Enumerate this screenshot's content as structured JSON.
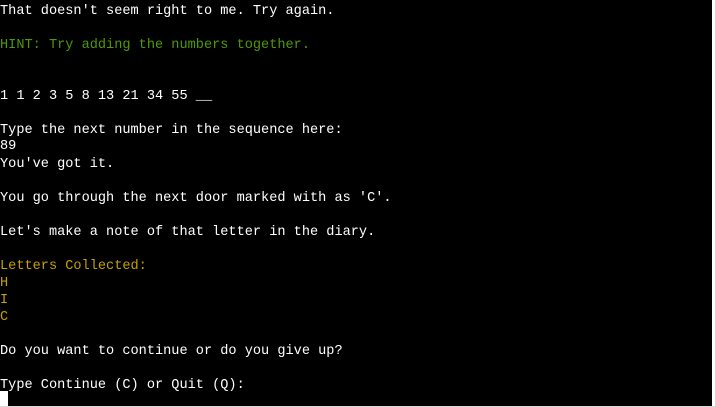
{
  "colors": {
    "background": "#000000",
    "text": "#ffffff",
    "hint": "#4e9a06",
    "letters": "#c4a000"
  },
  "terminal": {
    "error_message": "That doesn't seem right to me. Try again.",
    "hint": "HINT: Try adding the numbers together.",
    "sequence": "1 1 2 3 5 8 13 21 34 55 __",
    "prompt": "Type the next number in the sequence here:",
    "user_input": "89",
    "success": "You've got it.",
    "door_message": "You go through the next door marked with as 'C'.",
    "diary_message": "Let's make a note of that letter in the diary.",
    "letters_header": "Letters Collected:",
    "letters": [
      "H",
      "I",
      "C"
    ],
    "continue_question": "Do you want to continue or do you give up?",
    "continue_prompt": "Type Continue (C) or Quit (Q):"
  }
}
